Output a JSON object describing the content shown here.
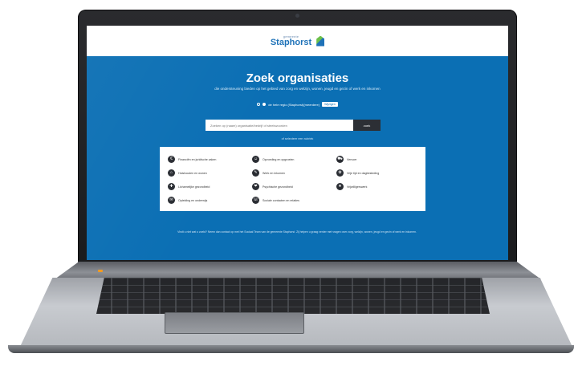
{
  "header": {
    "logo_small": "gemeente",
    "logo_big": "Staphorst"
  },
  "hero": {
    "title": "Zoek organisaties",
    "subtitle": "die ondersteuning bieden op het gebied van zorg en welzijn, wonen, jeugd en gezin of werk en inkomen"
  },
  "region": {
    "option_1": "",
    "option_2": "de hele regio (Staphorst)(meerdere)",
    "change_label": "Wijzigen"
  },
  "search": {
    "placeholder": "Zoeken op (naam) organisatie/bedrijf of steekwoorden",
    "button_label": "zoek"
  },
  "all_link": "of selecteer een rubriek",
  "categories": [
    {
      "icon": "money-icon",
      "glyph": "€",
      "label": "Financiën en juridische zaken"
    },
    {
      "icon": "family-icon",
      "glyph": "☺",
      "label": "Opvoeding en opgroeien"
    },
    {
      "icon": "transport-icon",
      "glyph": "⛟",
      "label": "Vervoer"
    },
    {
      "icon": "home-icon",
      "glyph": "⌂",
      "label": "Huishouden en wonen"
    },
    {
      "icon": "work-icon",
      "glyph": "✎",
      "label": "Werk en inkomen"
    },
    {
      "icon": "leisure-icon",
      "glyph": "✿",
      "label": "Vrije tijd en dagbesteding"
    },
    {
      "icon": "health-icon",
      "glyph": "✚",
      "label": "Lichamelijke gezondheid"
    },
    {
      "icon": "mental-icon",
      "glyph": "❤",
      "label": "Psychische gezondheid"
    },
    {
      "icon": "volunteer-icon",
      "glyph": "★",
      "label": "Vrijwilligerswerk"
    },
    {
      "icon": "education-icon",
      "glyph": "✉",
      "label": "Opleiding en onderwijs"
    },
    {
      "icon": "social-icon",
      "glyph": "☏",
      "label": "Sociale contacten en relaties"
    }
  ],
  "footer": {
    "text": "Vindt u niet wat u zoekt? Neem dan contact op met het Sociaal Team van de gemeente Staphorst. Zij helpen u graag verder met vragen over zorg, welzijn, wonen, jeugd en gezin of werk en inkomen."
  },
  "colors": {
    "screen_background": "#0b6fb4",
    "accent": "#1e72b8"
  }
}
